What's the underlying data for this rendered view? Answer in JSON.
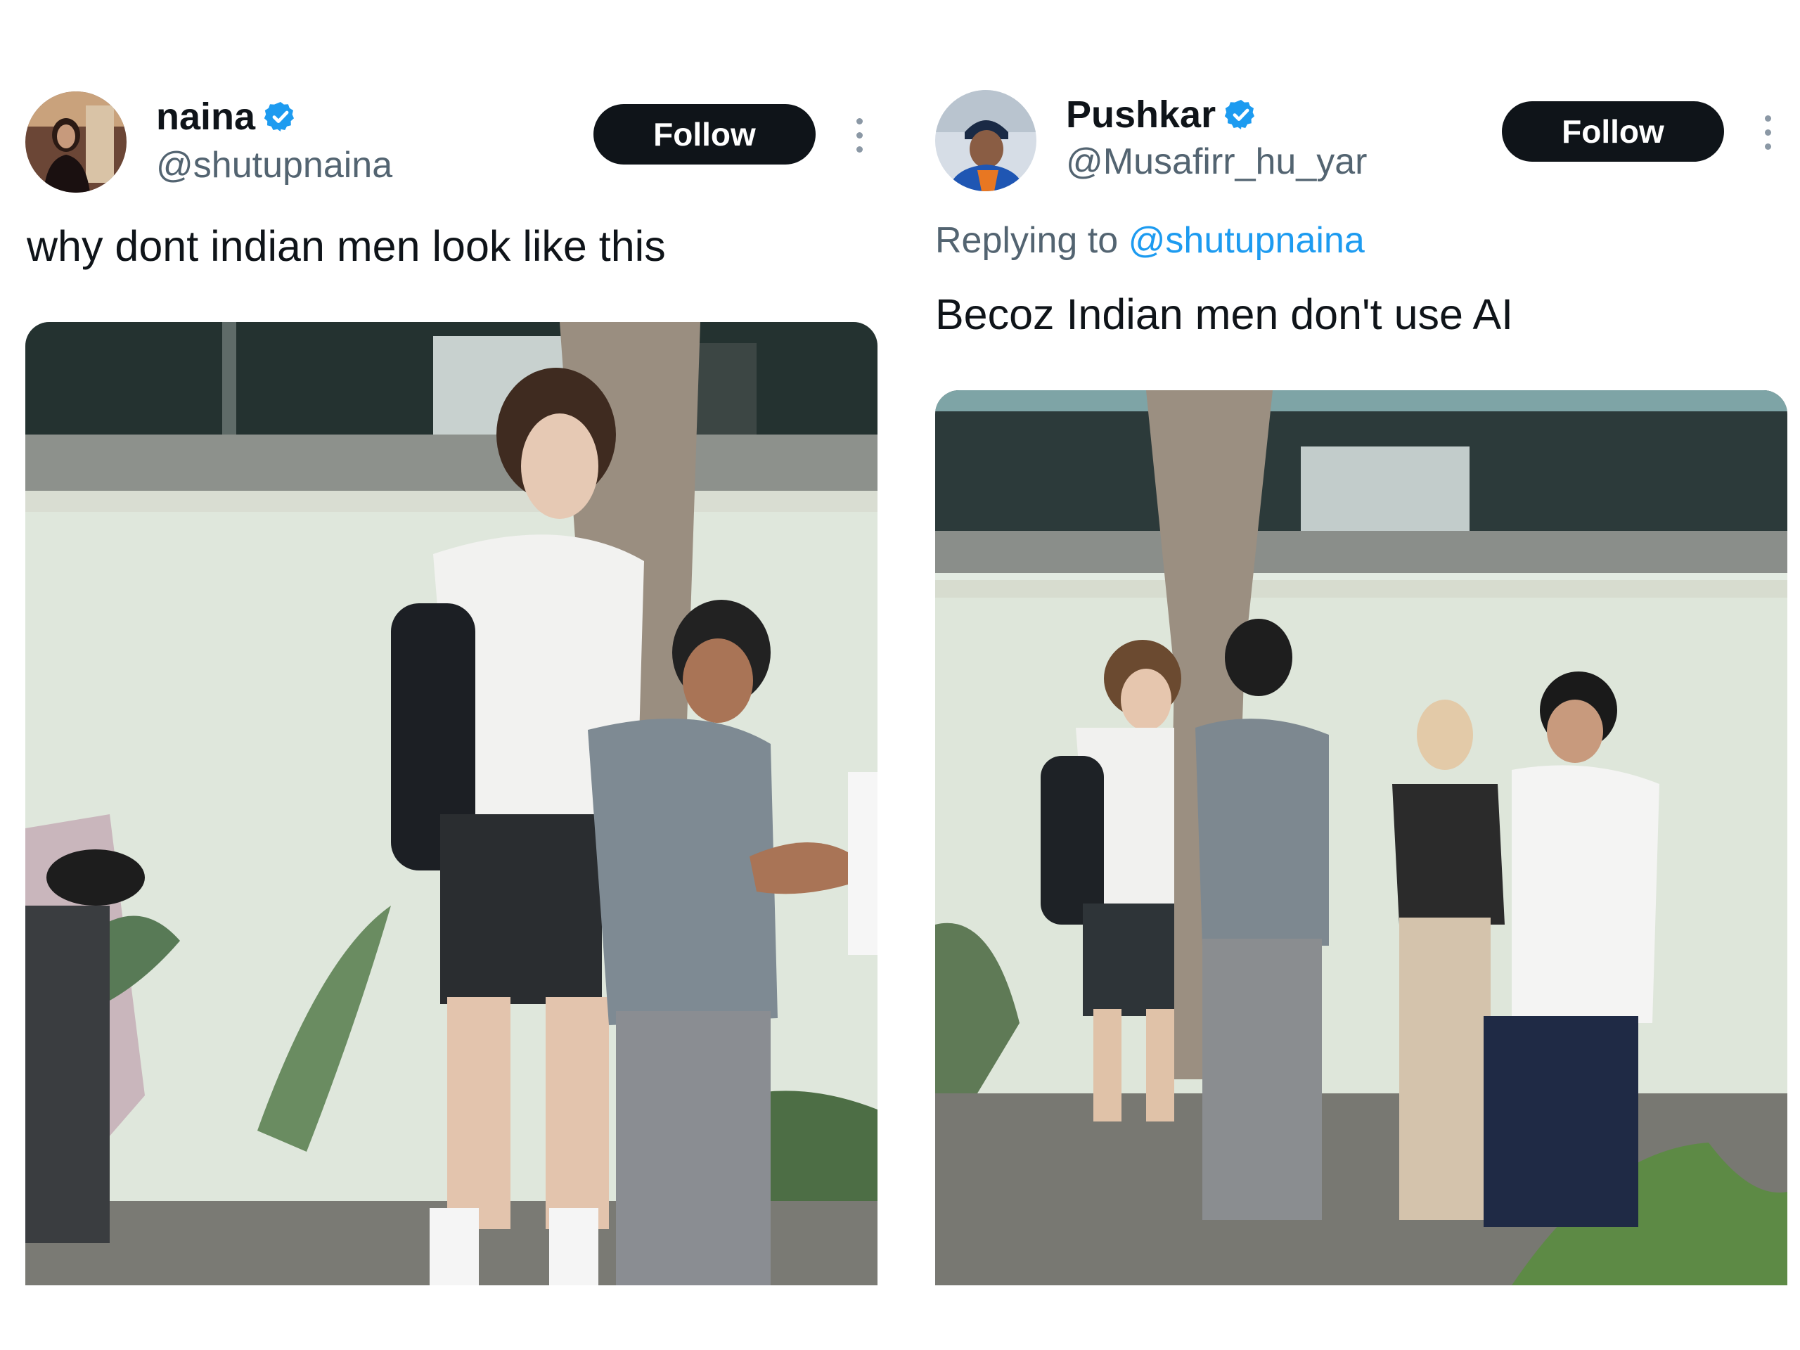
{
  "left_tweet": {
    "display_name": "naina",
    "handle": "@shutupnaina",
    "follow_label": "Follow",
    "text": "why dont indian men look like this",
    "avatar": "profile-photo",
    "verified_icon": "verified-badge-icon",
    "photo_description_icon": "photo"
  },
  "right_tweet": {
    "display_name": "Pushkar",
    "handle": "@Musafirr_hu_yar",
    "follow_label": "Follow",
    "replying_prefix": "Replying to",
    "replying_to": "@shutupnaina",
    "text": "Becoz Indian men don't use AI",
    "avatar": "profile-photo",
    "verified_icon": "verified-badge-icon"
  },
  "colors": {
    "text_primary": "#0f1419",
    "text_secondary": "#536471",
    "link": "#1d9bf0",
    "follow_bg": "#0f1419",
    "verified": "#1d9bf0"
  }
}
